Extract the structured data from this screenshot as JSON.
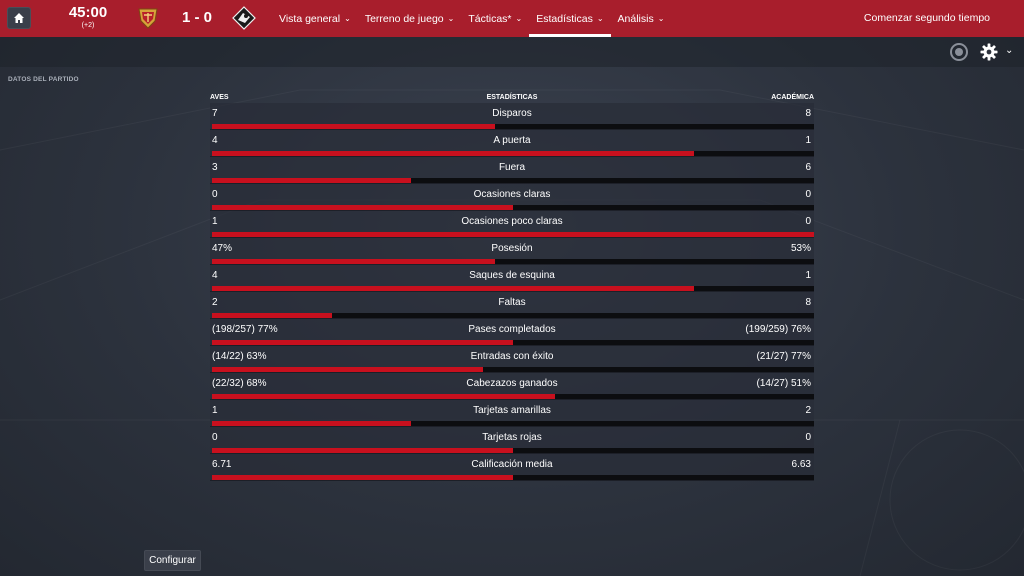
{
  "header": {
    "clock": "45:00",
    "added_time": "(+2)",
    "score": "1 - 0",
    "home_badge": "home-team-crest",
    "away_badge": "away-team-crest",
    "nav": [
      {
        "label": "Vista general",
        "active": false
      },
      {
        "label": "Terreno de juego",
        "active": false
      },
      {
        "label": "Tácticas*",
        "active": false
      },
      {
        "label": "Estadísticas",
        "active": true
      },
      {
        "label": "Análisis",
        "active": false
      }
    ],
    "continue_label": "Comenzar segundo tiempo"
  },
  "section_label": "DATOS DEL PARTIDO",
  "stats": {
    "home_team": "AVES",
    "title": "ESTADÍSTICAS",
    "away_team": "ACADÉMICA",
    "rows": [
      {
        "label": "Disparos",
        "home": "7",
        "away": "8",
        "home_share": 0.47
      },
      {
        "label": "A puerta",
        "home": "4",
        "away": "1",
        "home_share": 0.8
      },
      {
        "label": "Fuera",
        "home": "3",
        "away": "6",
        "home_share": 0.33
      },
      {
        "label": "Ocasiones claras",
        "home": "0",
        "away": "0",
        "home_share": 0.5
      },
      {
        "label": "Ocasiones poco claras",
        "home": "1",
        "away": "0",
        "home_share": 1.0
      },
      {
        "label": "Posesión",
        "home": "47%",
        "away": "53%",
        "home_share": 0.47
      },
      {
        "label": "Saques de esquina",
        "home": "4",
        "away": "1",
        "home_share": 0.8
      },
      {
        "label": "Faltas",
        "home": "2",
        "away": "8",
        "home_share": 0.2
      },
      {
        "label": "Pases completados",
        "home": "(198/257) 77%",
        "away": "(199/259) 76%",
        "home_share": 0.5
      },
      {
        "label": "Entradas con éxito",
        "home": "(14/22) 63%",
        "away": "(21/27) 77%",
        "home_share": 0.45
      },
      {
        "label": "Cabezazos ganados",
        "home": "(22/32) 68%",
        "away": "(14/27) 51%",
        "home_share": 0.57
      },
      {
        "label": "Tarjetas amarillas",
        "home": "1",
        "away": "2",
        "home_share": 0.33
      },
      {
        "label": "Tarjetas rojas",
        "home": "0",
        "away": "0",
        "home_share": 0.5
      },
      {
        "label": "Calificación media",
        "home": "6.71",
        "away": "6.63",
        "home_share": 0.5
      }
    ]
  },
  "config_label": "Configurar",
  "colors": {
    "topbar": "#a81e2c",
    "bar_fill": "#c8101e",
    "bar_track": "#0c0d10"
  }
}
